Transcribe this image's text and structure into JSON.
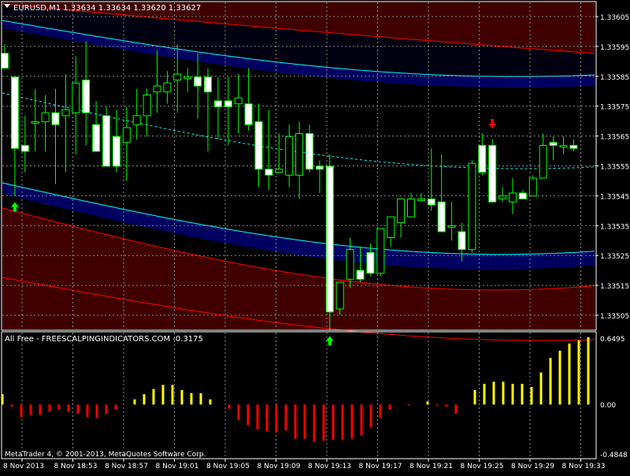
{
  "main_panel": {
    "header": "EURUSD,M1  1.33634 1.33634 1.33620 1.33627",
    "y_labels": [
      "1.33605",
      "1.33595",
      "1.33585",
      "1.33575",
      "1.33565",
      "1.33555",
      "1.33545",
      "1.33535",
      "1.33525",
      "1.33515",
      "1.33505"
    ],
    "colors": {
      "bull": "#00ff00",
      "bear": "#ffffff",
      "band_inner": "#00ffff",
      "band_outer": "#ff0000",
      "dark_red": "#400000",
      "dark_blue": "#000060"
    }
  },
  "indicator_panel": {
    "header": "All Free - FREESCALPINGINDICATORS.COM -0.3175",
    "y_labels": [
      "0.6495",
      "0.00",
      "-0.4848"
    ],
    "colors": {
      "positive": "#ffff00",
      "negative": "#ff0000"
    }
  },
  "footer": "MetaTrader 4, © 2001-2013, MetaQuotes Software Corp.",
  "x_labels": [
    "8 Nov 2013",
    "8 Nov 18:53",
    "8 Nov 18:57",
    "8 Nov 19:01",
    "8 Nov 19:05",
    "8 Nov 19:09",
    "8 Nov 19:13",
    "8 Nov 19:17",
    "8 Nov 19:21",
    "8 Nov 19:25",
    "8 Nov 19:29",
    "8 Nov 19:33"
  ],
  "chart_data": [
    {
      "type": "candlestick",
      "symbol": "EURUSD",
      "timeframe": "M1",
      "ylim": [
        1.335,
        1.3361
      ],
      "candles": [
        {
          "o": 1.33595,
          "h": 1.33598,
          "l": 1.3359,
          "c": 1.3359
        },
        {
          "o": 1.33587,
          "h": 1.33587,
          "l": 1.33547,
          "c": 1.33563
        },
        {
          "o": 1.33564,
          "h": 1.33574,
          "l": 1.33555,
          "c": 1.33562
        },
        {
          "o": 1.33572,
          "h": 1.33583,
          "l": 1.33562,
          "c": 1.33572
        },
        {
          "o": 1.33572,
          "h": 1.33581,
          "l": 1.33562,
          "c": 1.33575
        },
        {
          "o": 1.33575,
          "h": 1.33583,
          "l": 1.33551,
          "c": 1.33571
        },
        {
          "o": 1.33574,
          "h": 1.33588,
          "l": 1.33555,
          "c": 1.33576
        },
        {
          "o": 1.33575,
          "h": 1.33594,
          "l": 1.33561,
          "c": 1.33585
        },
        {
          "o": 1.33586,
          "h": 1.33599,
          "l": 1.33564,
          "c": 1.33575
        },
        {
          "o": 1.33571,
          "h": 1.33579,
          "l": 1.33564,
          "c": 1.33562
        },
        {
          "o": 1.33574,
          "h": 1.33577,
          "l": 1.33559,
          "c": 1.33557
        },
        {
          "o": 1.33567,
          "h": 1.33576,
          "l": 1.33555,
          "c": 1.33557
        },
        {
          "o": 1.33565,
          "h": 1.33577,
          "l": 1.33552,
          "c": 1.3357
        },
        {
          "o": 1.33571,
          "h": 1.33583,
          "l": 1.33566,
          "c": 1.33574
        },
        {
          "o": 1.33574,
          "h": 1.33583,
          "l": 1.33567,
          "c": 1.33581
        },
        {
          "o": 1.33582,
          "h": 1.33596,
          "l": 1.33575,
          "c": 1.33584
        },
        {
          "o": 1.33582,
          "h": 1.33589,
          "l": 1.33578,
          "c": 1.33585
        },
        {
          "o": 1.33586,
          "h": 1.33598,
          "l": 1.33575,
          "c": 1.33588
        },
        {
          "o": 1.33587,
          "h": 1.3359,
          "l": 1.33582,
          "c": 1.33587
        },
        {
          "o": 1.33587,
          "h": 1.33595,
          "l": 1.33573,
          "c": 1.33584
        },
        {
          "o": 1.33587,
          "h": 1.3359,
          "l": 1.33562,
          "c": 1.33582
        },
        {
          "o": 1.33579,
          "h": 1.33587,
          "l": 1.33566,
          "c": 1.33577
        },
        {
          "o": 1.33579,
          "h": 1.33587,
          "l": 1.33564,
          "c": 1.33577
        },
        {
          "o": 1.33578,
          "h": 1.33588,
          "l": 1.33568,
          "c": 1.3358
        },
        {
          "o": 1.33578,
          "h": 1.3359,
          "l": 1.33569,
          "c": 1.33571
        },
        {
          "o": 1.33572,
          "h": 1.33578,
          "l": 1.3355,
          "c": 1.33556
        },
        {
          "o": 1.33556,
          "h": 1.33576,
          "l": 1.33549,
          "c": 1.33554
        },
        {
          "o": 1.33555,
          "h": 1.33568,
          "l": 1.33555,
          "c": 1.33556
        },
        {
          "o": 1.33554,
          "h": 1.33571,
          "l": 1.3355,
          "c": 1.33567
        },
        {
          "o": 1.33554,
          "h": 1.33572,
          "l": 1.33546,
          "c": 1.33568
        },
        {
          "o": 1.33568,
          "h": 1.33571,
          "l": 1.33555,
          "c": 1.33556
        },
        {
          "o": 1.33557,
          "h": 1.33559,
          "l": 1.33548,
          "c": 1.33556
        },
        {
          "o": 1.33557,
          "h": 1.33561,
          "l": 1.33502,
          "c": 1.33508
        },
        {
          "o": 1.33509,
          "h": 1.33518,
          "l": 1.33507,
          "c": 1.33518
        },
        {
          "o": 1.33519,
          "h": 1.33533,
          "l": 1.33516,
          "c": 1.33529
        },
        {
          "o": 1.33522,
          "h": 1.3353,
          "l": 1.33518,
          "c": 1.33519
        },
        {
          "o": 1.33528,
          "h": 1.33531,
          "l": 1.3352,
          "c": 1.33521
        },
        {
          "o": 1.33521,
          "h": 1.33533,
          "l": 1.3352,
          "c": 1.33536
        },
        {
          "o": 1.33533,
          "h": 1.33537,
          "l": 1.3353,
          "c": 1.3354
        },
        {
          "o": 1.33538,
          "h": 1.33545,
          "l": 1.33533,
          "c": 1.33546
        },
        {
          "o": 1.3354,
          "h": 1.33548,
          "l": 1.3354,
          "c": 1.33546
        },
        {
          "o": 1.33546,
          "h": 1.33548,
          "l": 1.33545,
          "c": 1.33546
        },
        {
          "o": 1.33546,
          "h": 1.33563,
          "l": 1.33542,
          "c": 1.33544
        },
        {
          "o": 1.33545,
          "h": 1.33561,
          "l": 1.33535,
          "c": 1.33535
        },
        {
          "o": 1.33537,
          "h": 1.33545,
          "l": 1.33532,
          "c": 1.33537
        },
        {
          "o": 1.33535,
          "h": 1.33538,
          "l": 1.33525,
          "c": 1.33529
        },
        {
          "o": 1.33529,
          "h": 1.33559,
          "l": 1.33528,
          "c": 1.33558
        },
        {
          "o": 1.33564,
          "h": 1.33568,
          "l": 1.33554,
          "c": 1.33555
        },
        {
          "o": 1.33564,
          "h": 1.33566,
          "l": 1.33545,
          "c": 1.33545
        },
        {
          "o": 1.33546,
          "h": 1.3355,
          "l": 1.33545,
          "c": 1.33547
        },
        {
          "o": 1.33545,
          "h": 1.33553,
          "l": 1.33541,
          "c": 1.33548
        },
        {
          "o": 1.33548,
          "h": 1.33549,
          "l": 1.33546,
          "c": 1.33546
        },
        {
          "o": 1.33547,
          "h": 1.33554,
          "l": 1.33547,
          "c": 1.33553
        },
        {
          "o": 1.33553,
          "h": 1.33568,
          "l": 1.33553,
          "c": 1.33564
        },
        {
          "o": 1.33565,
          "h": 1.33567,
          "l": 1.33559,
          "c": 1.33564
        },
        {
          "o": 1.33564,
          "h": 1.33567,
          "l": 1.33561,
          "c": 1.33564
        },
        {
          "o": 1.33564,
          "h": 1.33566,
          "l": 1.33562,
          "c": 1.33563
        }
      ],
      "arrows": [
        {
          "index": 1,
          "direction": "up",
          "at": "low"
        },
        {
          "index": 32,
          "direction": "up",
          "at": "low"
        },
        {
          "index": 48,
          "direction": "down",
          "at": "high"
        }
      ]
    },
    {
      "type": "bar",
      "ylim": [
        -0.4848,
        0.6495
      ],
      "values": [
        0.1,
        -0.02,
        -0.12,
        -0.1,
        -0.1,
        -0.07,
        -0.05,
        -0.07,
        -0.09,
        -0.12,
        -0.13,
        -0.09,
        -0.05,
        0.0,
        0.05,
        0.1,
        0.15,
        0.19,
        0.19,
        0.14,
        0.11,
        0.11,
        0.05,
        0.0,
        -0.04,
        -0.15,
        -0.2,
        -0.24,
        -0.26,
        -0.27,
        -0.25,
        -0.33,
        -0.33,
        -0.36,
        -0.35,
        -0.34,
        -0.34,
        -0.33,
        -0.3,
        -0.22,
        -0.13,
        -0.05,
        0.0,
        -0.01,
        0.0,
        0.03,
        -0.01,
        -0.02,
        -0.09,
        0.0,
        0.14,
        0.2,
        0.22,
        0.22,
        0.2,
        0.2,
        0.17,
        0.31,
        0.45,
        0.52,
        0.59,
        0.62,
        0.65
      ]
    }
  ]
}
